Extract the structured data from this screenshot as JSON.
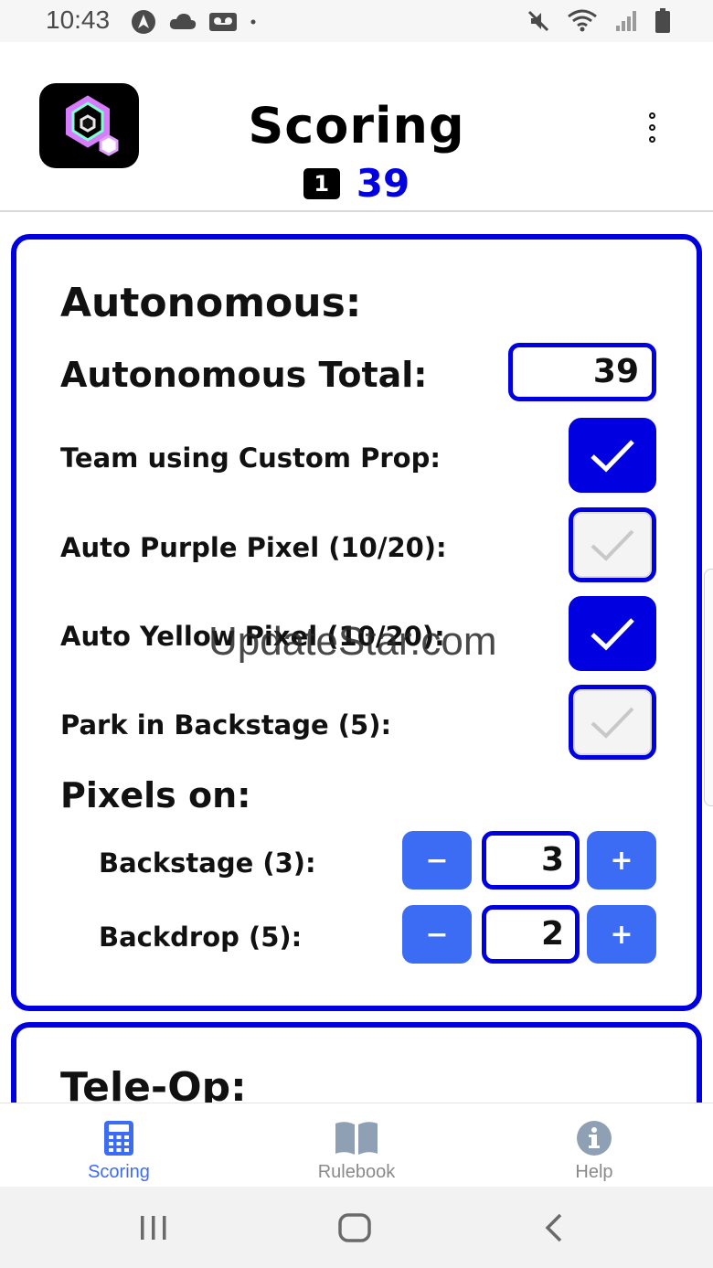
{
  "status_bar": {
    "time": "10:43",
    "left_icons": [
      "nav-arrow-icon",
      "cloud-icon",
      "voicemail-icon",
      "dot-icon"
    ],
    "right_icons": [
      "mute-icon",
      "wifi-icon",
      "signal-icon",
      "battery-icon"
    ]
  },
  "header": {
    "title": "Scoring",
    "team_badge": "1",
    "total_score": "39"
  },
  "autonomous": {
    "heading": "Autonomous:",
    "total_label": "Autonomous Total:",
    "total_value": "39",
    "checkbox_rows": [
      {
        "label": "Team using Custom Prop:",
        "checked": true
      },
      {
        "label": "Auto Purple Pixel (10/20):",
        "checked": false
      },
      {
        "label": "Auto Yellow Pixel (10/20):",
        "checked": true
      },
      {
        "label": "Park in Backstage (5):",
        "checked": false
      }
    ],
    "pixels_heading": "Pixels on:",
    "pixel_rows": [
      {
        "label": "Backstage (3):",
        "value": "3",
        "minus": "−",
        "plus": "+"
      },
      {
        "label": "Backdrop (5):",
        "value": "2",
        "minus": "−",
        "plus": "+"
      }
    ]
  },
  "teleop": {
    "heading": "Tele-Op:"
  },
  "watermark": "UpdateStar.com",
  "bottom_nav": {
    "items": [
      {
        "label": "Scoring",
        "icon": "calculator-icon",
        "active": true
      },
      {
        "label": "Rulebook",
        "icon": "book-icon",
        "active": false
      },
      {
        "label": "Help",
        "icon": "info-icon",
        "active": false
      }
    ]
  },
  "colors": {
    "accent_blue": "#0000e0",
    "button_blue": "#3d6cf4",
    "inactive_gray": "#8a8a8a"
  }
}
